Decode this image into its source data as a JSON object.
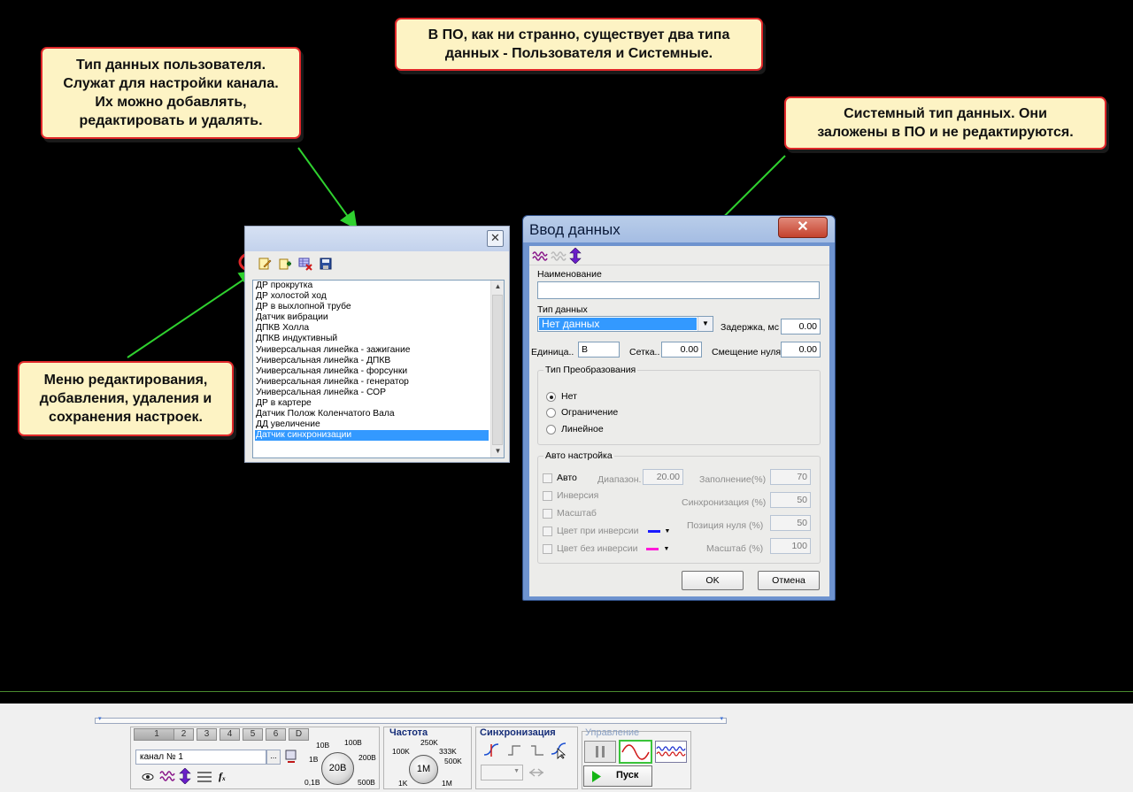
{
  "callouts": {
    "user_types": "Тип данных пользователя.\nСлужат для настройки канала.\nИх можно добавлять,\nредактировать и удалять.",
    "two_types": "В ПО, как ни странно, существует два типа\nданных - Пользователя и Системные.",
    "system_types": "Системный тип данных. Они\nзаложены в ПО и не редактируются.",
    "edit_menu": "Меню редактирования,\nдобавления, удаления и\nсохранения настроек."
  },
  "list_window": {
    "close_symbol": "✕",
    "toolbar_icons": [
      "edit-icon",
      "add-icon",
      "delete-icon",
      "save-icon"
    ],
    "items": [
      "ДР прокрутка",
      "ДР холостой ход",
      "ДР в выхлопной трубе",
      "Датчик вибрации",
      "ДПКВ Холла",
      "ДПКВ индуктивный",
      "Универсальная линейка - зажигание",
      "Универсальная линейка - ДПКВ",
      "Универсальная линейка - форсунки",
      "Универсальная линейка - генератор",
      "Универсальная линейка - СОР",
      "ДР в картере",
      "Датчик Полож Коленчатого Вала",
      "ДД увеличение",
      "Датчик синхронизации"
    ],
    "selected_index": 14
  },
  "dialog": {
    "title": "Ввод данных",
    "close_symbol": "✕",
    "name_label": "Наименование",
    "name_value": "",
    "type_label": "Тип данных",
    "type_value": "Нет данных",
    "delay_label": "Задержка, мс",
    "delay_value": "0.00",
    "unit_label": "Единица..",
    "unit_value": "В",
    "grid_label": "Сетка..",
    "grid_value": "0.00",
    "offset_label": "Смещение нуля",
    "offset_value": "0.00",
    "transform_group": "Тип Преобразования",
    "transform_options": [
      "Нет",
      "Ограничение",
      "Линейное"
    ],
    "transform_selected": 0,
    "auto_group": "Авто настройка",
    "auto_checks": [
      "Авто",
      "Инверсия",
      "Масштаб",
      "Цвет при инверсии",
      "Цвет без инверсии"
    ],
    "range_label": "Диапазон.",
    "range_value": "20.00",
    "fill_label": "Заполнение(%)",
    "fill_value": "70",
    "sync_label": "Синхронизация (%)",
    "sync_value": "50",
    "zero_pos_label": "Позиция нуля (%)",
    "zero_pos_value": "50",
    "scale_label": "Масштаб (%)",
    "scale_value": "100",
    "inverse_color": "#1a1aff",
    "noninverse_color": "#ff1ad9",
    "ok_label": "OK",
    "cancel_label": "Отмена"
  },
  "bottom_panel": {
    "channel_tabs": [
      "1",
      "2",
      "3",
      "4",
      "5",
      "6",
      "D"
    ],
    "channel_value": "канал № 1",
    "browse_label": "...",
    "volt_labels": [
      "10В",
      "100В",
      "1В",
      "200В",
      "0,1В",
      "500В"
    ],
    "volt_knob": "20В",
    "freq_title": "Частота",
    "freq_labels": [
      "250K",
      "100K",
      "333K",
      "500K",
      "1K",
      "1M"
    ],
    "freq_knob": "1M",
    "sync_title": "Синхронизация",
    "control_title": "Управление",
    "start_label": "Пуск"
  }
}
